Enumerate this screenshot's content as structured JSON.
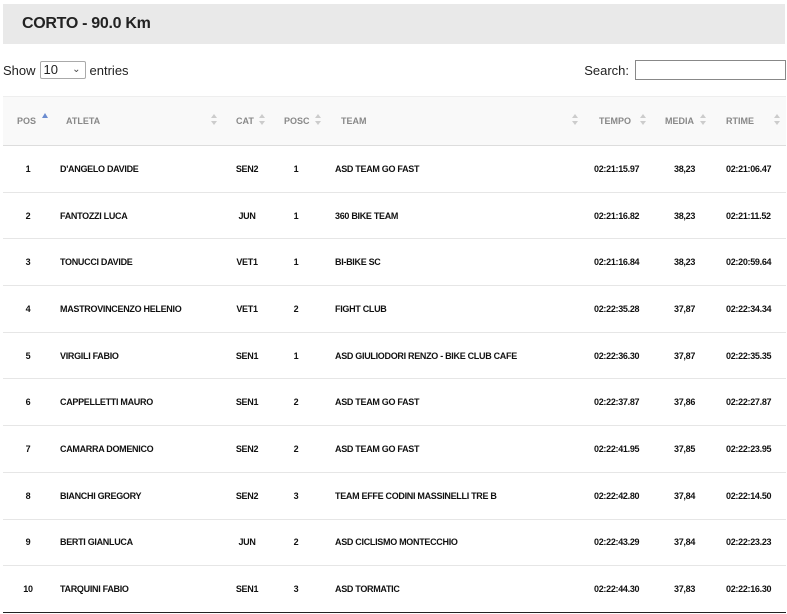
{
  "page": {
    "title": "CORTO - 90.0 Km",
    "show_label": "Show",
    "entries_value": "10",
    "entries_label": "entries",
    "search_label": "Search:",
    "search_value": ""
  },
  "table": {
    "headers": [
      "POS",
      "ATLETA",
      "CAT",
      "POSC",
      "TEAM",
      "TEMPO",
      "MEDIA",
      "RTIME"
    ],
    "rows": [
      [
        "1",
        "D'ANGELO DAVIDE",
        "SEN2",
        "1",
        "ASD TEAM GO FAST",
        "02:21:15.97",
        "38,23",
        "02:21:06.47"
      ],
      [
        "2",
        "FANTOZZI LUCA",
        "JUN",
        "1",
        "360 BIKE TEAM",
        "02:21:16.82",
        "38,23",
        "02:21:11.52"
      ],
      [
        "3",
        "TONUCCI DAVIDE",
        "VET1",
        "1",
        "BI-BIKE SC",
        "02:21:16.84",
        "38,23",
        "02:20:59.64"
      ],
      [
        "4",
        "MASTROVINCENZO HELENIO",
        "VET1",
        "2",
        "FIGHT CLUB",
        "02:22:35.28",
        "37,87",
        "02:22:34.34"
      ],
      [
        "5",
        "VIRGILI FABIO",
        "SEN1",
        "1",
        "ASD GIULIODORI RENZO - BIKE CLUB CAFE",
        "02:22:36.30",
        "37,87",
        "02:22:35.35"
      ],
      [
        "6",
        "CAPPELLETTI MAURO",
        "SEN1",
        "2",
        "ASD TEAM GO FAST",
        "02:22:37.87",
        "37,86",
        "02:22:27.87"
      ],
      [
        "7",
        "CAMARRA DOMENICO",
        "SEN2",
        "2",
        "ASD TEAM GO FAST",
        "02:22:41.95",
        "37,85",
        "02:22:23.95"
      ],
      [
        "8",
        "BIANCHI GREGORY",
        "SEN2",
        "3",
        "TEAM EFFE CODINI MASSINELLI TRE B",
        "02:22:42.80",
        "37,84",
        "02:22:14.50"
      ],
      [
        "9",
        "BERTI GIANLUCA",
        "JUN",
        "2",
        "ASD CICLISMO MONTECCHIO",
        "02:22:43.29",
        "37,84",
        "02:22:23.23"
      ],
      [
        "10",
        "TARQUINI FABIO",
        "SEN1",
        "3",
        "ASD TORMATIC",
        "02:22:44.30",
        "37,83",
        "02:22:16.30"
      ]
    ]
  },
  "colors": {
    "title_bg": "#e9e9e9",
    "header_text": "#888888",
    "sort_active": "#6b8cd0"
  }
}
